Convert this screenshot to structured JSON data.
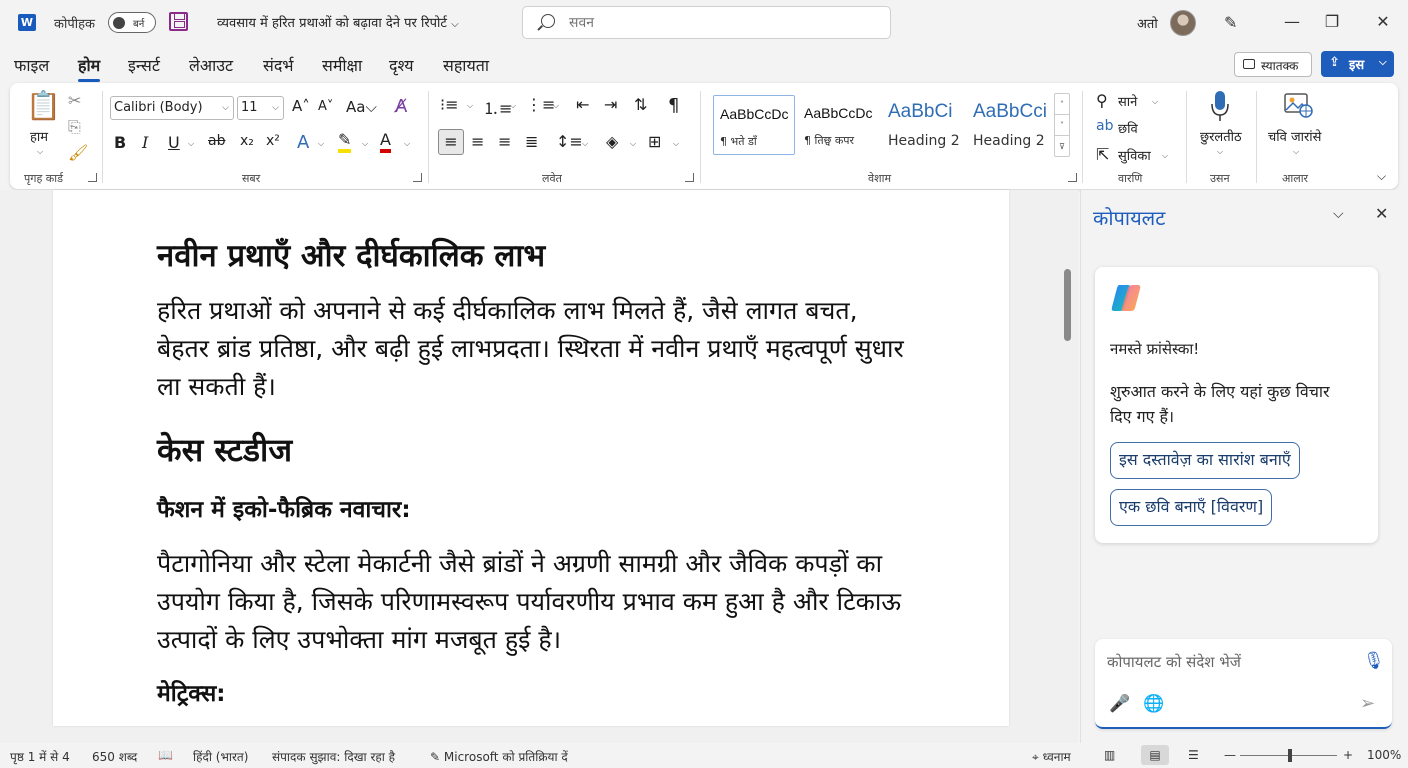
{
  "titlebar": {
    "app_logo": "W",
    "autosave_label": "कोपीहक",
    "toggle_label": "बर्न",
    "doc_title": "व्यवसाय में हरित प्रथाओं को बढ़ावा देने पर रिपोर्ट",
    "search_placeholder": "सवन",
    "user_name": "अतो",
    "minimize": "—",
    "restore": "❐",
    "close": "✕"
  },
  "tabs": [
    "फाइल",
    "होम",
    "इन्सर्ट",
    "लेआउट",
    "संदर्भ",
    "समीक्षा",
    "दृश्य",
    "सहायता"
  ],
  "active_tab": "होम",
  "comments_label": "स्यातक्क",
  "share_label": "इस",
  "ribbon": {
    "clipboard": {
      "paste_label": "हाम",
      "group": "पृगह कार्ड"
    },
    "font": {
      "family": "Calibri (Body)",
      "size": "11",
      "group": "सबर"
    },
    "paragraph": {
      "group": "लवेत"
    },
    "styles": {
      "group": "वेशाम",
      "items": [
        {
          "sample": "AaBbCcDc",
          "name": "¶ भते डॉं"
        },
        {
          "sample": "AaBbCcDc",
          "name": "¶ तिछ्व कपर"
        },
        {
          "sample": "AaBbCi",
          "name": "Heading 2"
        },
        {
          "sample": "AaBbCci",
          "name": "Heading 2"
        }
      ]
    },
    "editing": {
      "find": "साने",
      "replace": "छवि",
      "select": "सुविका",
      "group": "वारणि"
    },
    "voice": {
      "label": "छुरलतीठ",
      "group": "उसन"
    },
    "addins": {
      "label": "चवि जारांसे",
      "group": "आलार"
    }
  },
  "document": {
    "heading1": "नवीन प्रथाएँ और दीर्घकालिक लाभ",
    "para1": "हरित प्रथाओं को अपनाने से कई दीर्घकालिक लाभ मिलते हैं, जैसे लागत बचत, बेहतर ब्रांड प्रतिष्ठा, और बढ़ी हुई लाभप्रदता। स्थिरता में नवीन प्रथाएँ महत्वपूर्ण सुधार ला सकती हैं।",
    "heading2": "केस स्टडीज",
    "subheading1": "फैशन में इको-फैब्रिक नवाचार:",
    "para2": "पैटागोनिया और स्टेला मेकार्टनी जैसे ब्रांडों ने अग्रणी सामग्री और जैविक कपड़ों का उपयोग किया है, जिसके परिणामस्वरूप पर्यावरणीय प्रभाव कम हुआ है और टिकाऊ उत्पादों के लिए उपभोक्ता मांग मजबूत हुई है।",
    "subheading2": "मेट्रिक्स:"
  },
  "copilot": {
    "title": "कोपायलट",
    "greeting": "नमस्ते फ्रांसेस्का!",
    "intro": "शुरुआत करने के लिए यहां कुछ विचार दिए गए हैं।",
    "suggestions": [
      "इस दस्तावेज़ का सारांश बनाएँ",
      "एक छवि बनाएँ [विवरण]"
    ],
    "input_placeholder": "कोपायलट को संदेश भेजें"
  },
  "statusbar": {
    "page": "पृष्ठ 1 में से 4",
    "words": "650 शब्द",
    "language": "हिंदी (भारत)",
    "editor": "संपादक सुझाव: दिखा रहा है",
    "feedback": "Microsoft को प्रतिक्रिया दें",
    "focus": "ध्वनाम",
    "zoom": "100%"
  },
  "colors": {
    "accent": "#185abd",
    "copilot_title": "#1f5dbd"
  }
}
